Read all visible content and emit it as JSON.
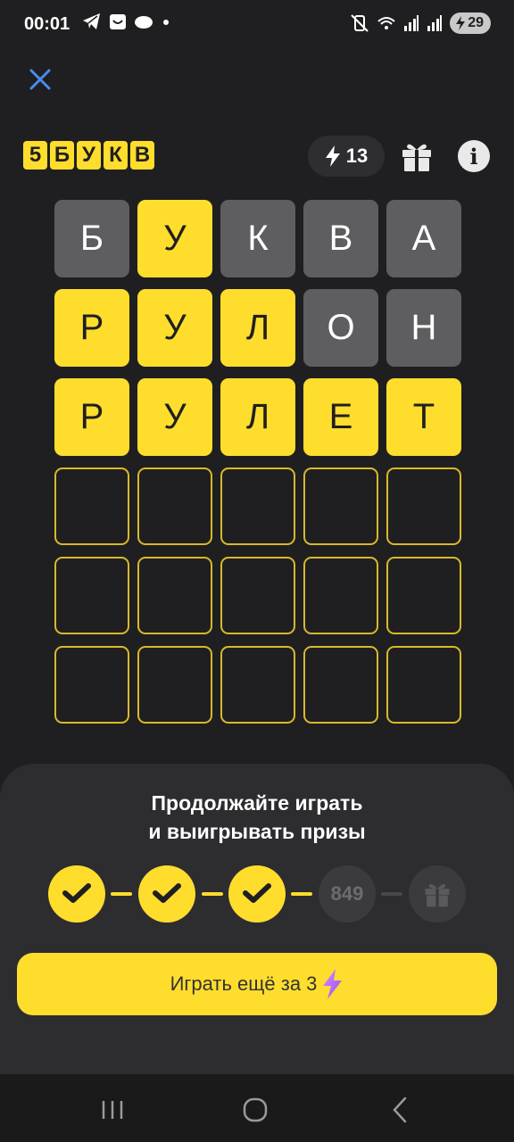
{
  "status": {
    "time": "00:01",
    "battery": "29"
  },
  "logo": {
    "letters": [
      "5",
      "Б",
      "У",
      "К",
      "В"
    ]
  },
  "header": {
    "energy_count": "13"
  },
  "board": {
    "rows": [
      [
        {
          "letter": "Б",
          "state": "absent"
        },
        {
          "letter": "У",
          "state": "correct"
        },
        {
          "letter": "К",
          "state": "absent"
        },
        {
          "letter": "В",
          "state": "absent"
        },
        {
          "letter": "А",
          "state": "absent"
        }
      ],
      [
        {
          "letter": "Р",
          "state": "correct"
        },
        {
          "letter": "У",
          "state": "correct"
        },
        {
          "letter": "Л",
          "state": "correct"
        },
        {
          "letter": "О",
          "state": "absent"
        },
        {
          "letter": "Н",
          "state": "absent"
        }
      ],
      [
        {
          "letter": "Р",
          "state": "correct"
        },
        {
          "letter": "У",
          "state": "correct"
        },
        {
          "letter": "Л",
          "state": "correct"
        },
        {
          "letter": "Е",
          "state": "correct"
        },
        {
          "letter": "Т",
          "state": "correct"
        }
      ],
      [
        {
          "letter": "",
          "state": "empty"
        },
        {
          "letter": "",
          "state": "empty"
        },
        {
          "letter": "",
          "state": "empty"
        },
        {
          "letter": "",
          "state": "empty"
        },
        {
          "letter": "",
          "state": "empty"
        }
      ],
      [
        {
          "letter": "",
          "state": "empty"
        },
        {
          "letter": "",
          "state": "empty"
        },
        {
          "letter": "",
          "state": "empty"
        },
        {
          "letter": "",
          "state": "empty"
        },
        {
          "letter": "",
          "state": "empty"
        }
      ],
      [
        {
          "letter": "",
          "state": "empty"
        },
        {
          "letter": "",
          "state": "empty"
        },
        {
          "letter": "",
          "state": "empty"
        },
        {
          "letter": "",
          "state": "empty"
        },
        {
          "letter": "",
          "state": "empty"
        }
      ]
    ]
  },
  "sheet": {
    "title_line1": "Продолжайте играть",
    "title_line2": "и выигрывать призы",
    "progress_step4_label": "849",
    "play_label": "Играть ещё за 3"
  },
  "colors": {
    "accent": "#ffdd2d",
    "tile_absent": "#5e5e61",
    "background": "#1f1f21"
  }
}
